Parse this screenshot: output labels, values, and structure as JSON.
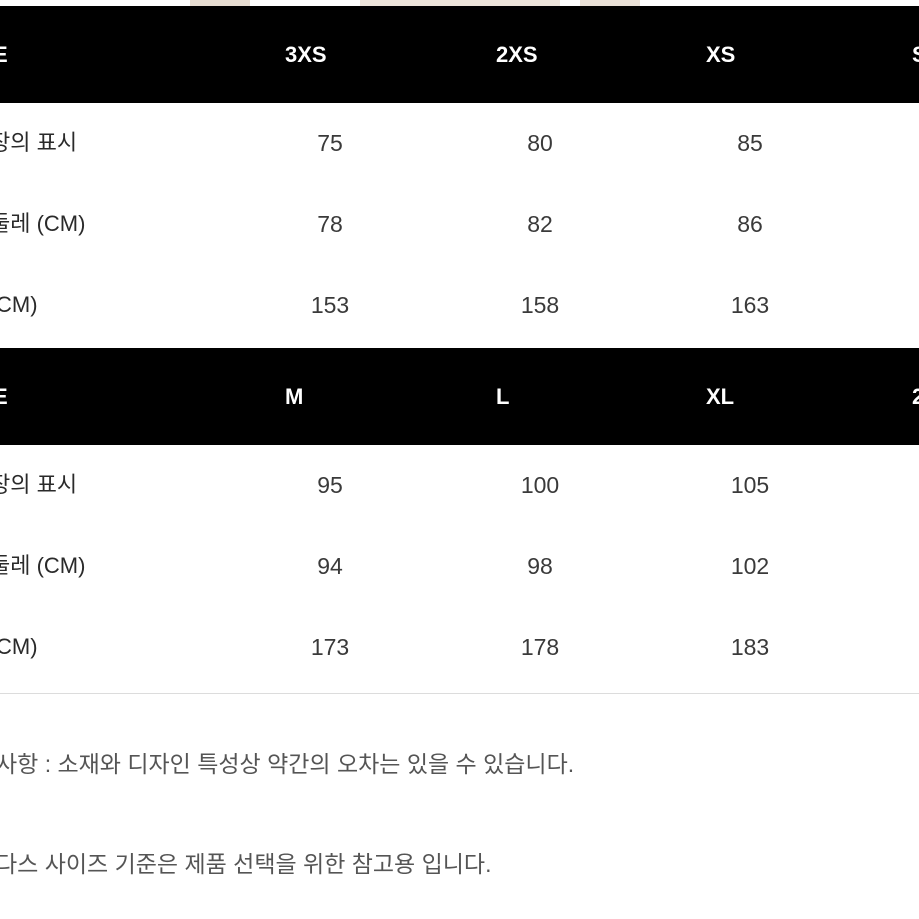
{
  "colors": {
    "header_bg": "#000000",
    "header_text": "#ffffff",
    "body_text": "#333333",
    "note_text": "#555555",
    "divider": "#dcdcdc"
  },
  "tables": [
    {
      "header": {
        "label": "E",
        "sizes": [
          "3XS",
          "2XS",
          "XS"
        ],
        "edge": "S"
      },
      "rows": [
        {
          "label": "장의 표시",
          "values": [
            "75",
            "80",
            "85"
          ]
        },
        {
          "label": "둘레 (CM)",
          "values": [
            "78",
            "82",
            "86"
          ]
        },
        {
          "label": "CM)",
          "values": [
            "153",
            "158",
            "163"
          ]
        }
      ]
    },
    {
      "header": {
        "label": "E",
        "sizes": [
          "M",
          "L",
          "XL"
        ],
        "edge": "2"
      },
      "rows": [
        {
          "label": "장의 표시",
          "values": [
            "95",
            "100",
            "105"
          ]
        },
        {
          "label": "둘레 (CM)",
          "values": [
            "94",
            "98",
            "102"
          ]
        },
        {
          "label": "CM)",
          "values": [
            "173",
            "178",
            "183"
          ]
        }
      ]
    }
  ],
  "notes": [
    "사항 : 소재와 디자인 특성상 약간의 오차는 있을 수 있습니다.",
    "다스 사이즈 기준은 제품 선택을 위한 참고용 입니다."
  ]
}
